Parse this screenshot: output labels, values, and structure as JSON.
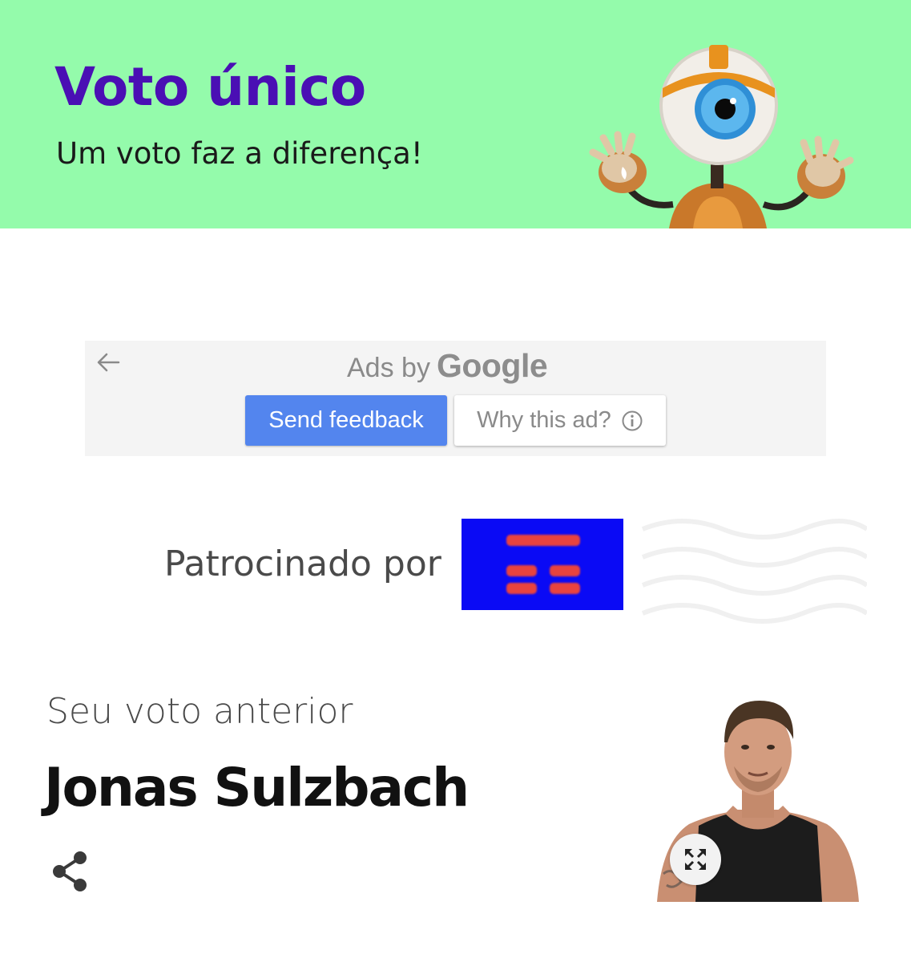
{
  "banner": {
    "title": "Voto único",
    "subtitle": "Um voto faz a diferença!",
    "background_color": "#94fbab",
    "title_color": "#4a0fb4",
    "mascot_icon": "big-brother-eye-mascot"
  },
  "ad": {
    "back_icon": "arrow-left-icon",
    "ads_by_label": "Ads by",
    "google_label": "Google",
    "send_feedback_label": "Send feedback",
    "why_this_ad_label": "Why this ad?",
    "info_icon": "info-icon",
    "send_feedback_color": "#5385ee"
  },
  "sponsor": {
    "label": "Patrocinado por",
    "logo_background": "#0a0af5",
    "logo_bars_color": "#e8433f"
  },
  "previous_vote": {
    "label": "Seu voto anterior",
    "candidate_name": "Jonas Sulzbach",
    "share_icon": "share-icon",
    "expand_icon": "expand-arrows-icon",
    "photo": "candidate-photo"
  }
}
